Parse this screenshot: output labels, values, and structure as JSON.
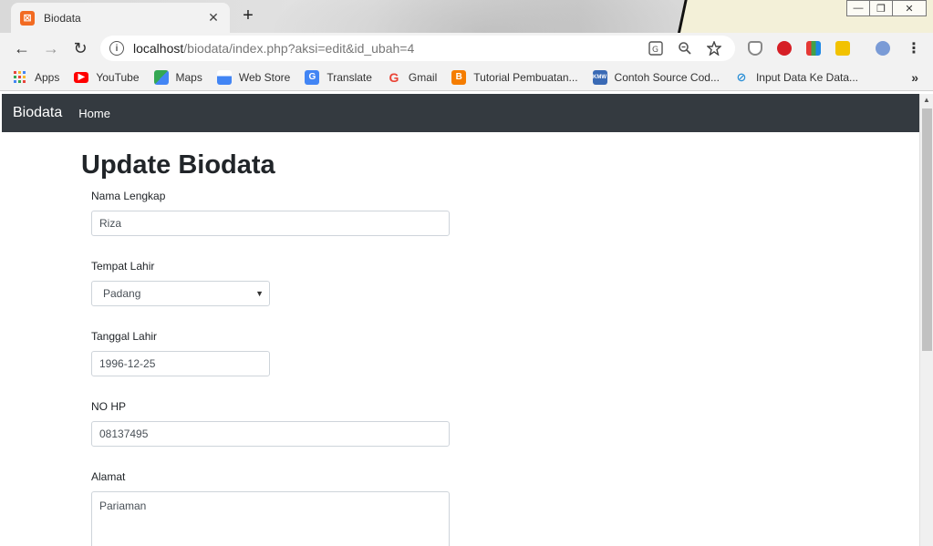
{
  "browser": {
    "tab_title": "Biodata",
    "tab_close": "✕",
    "new_tab": "+",
    "url_host": "localhost",
    "url_path": "/biodata/index.php?aksi=edit&id_ubah=4",
    "win_minimize": "—",
    "win_restore": "❐",
    "win_close": "✕",
    "back": "←",
    "forward": "→",
    "reload": "↻",
    "more_menu": "⋮"
  },
  "bookmarks": {
    "items": [
      {
        "label": "Apps",
        "icon": "apps-grid-icon",
        "color": "#e8453c"
      },
      {
        "label": "YouTube",
        "icon": "youtube-icon",
        "color": "#ff0000"
      },
      {
        "label": "Maps",
        "icon": "maps-icon",
        "color": "#34a853"
      },
      {
        "label": "Web Store",
        "icon": "webstore-icon",
        "color": "#4285f4"
      },
      {
        "label": "Translate",
        "icon": "translate-icon",
        "color": "#4285f4"
      },
      {
        "label": "Gmail",
        "icon": "google-icon",
        "color": "#ea4335"
      },
      {
        "label": "Tutorial Pembuatan...",
        "icon": "blogger-icon",
        "color": "#f57d00"
      },
      {
        "label": "Contoh Source Cod...",
        "icon": "kmw-icon",
        "color": "#3a6ab5"
      },
      {
        "label": "Input Data Ke Data...",
        "icon": "link-icon",
        "color": "#2b8fd6"
      }
    ],
    "more": "»"
  },
  "navbar": {
    "brand": "Biodata",
    "home": "Home"
  },
  "form": {
    "title": "Update Biodata",
    "nama_label": "Nama Lengkap",
    "nama_value": "Riza",
    "tempat_label": "Tempat Lahir",
    "tempat_value": "Padang",
    "tanggal_label": "Tanggal Lahir",
    "tanggal_value": "1996-12-25",
    "hp_label": "NO HP",
    "hp_value": "08137495",
    "alamat_label": "Alamat",
    "alamat_value": "Pariaman"
  },
  "colors": {
    "navbar_bg": "#343a40",
    "tab_favicon": "#f26b22"
  }
}
